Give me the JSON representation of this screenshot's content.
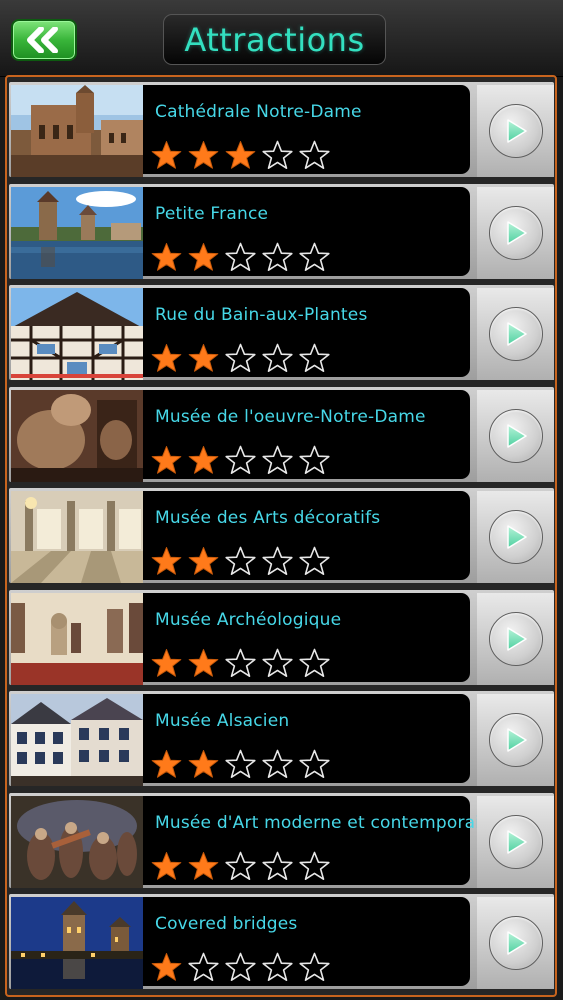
{
  "header": {
    "title": "Attractions",
    "back_icon": "double-chevron-left-icon"
  },
  "colors": {
    "accent_title": "#33e0c0",
    "item_name": "#47d8e8",
    "star_filled": "#ff7a1a",
    "frame_border": "#c8641e",
    "back_button": "#39b53a"
  },
  "items": [
    {
      "name": "Cathédrale Notre-Dame",
      "rating": 3,
      "max_rating": 5,
      "thumb": "cathedral"
    },
    {
      "name": "Petite France",
      "rating": 2,
      "max_rating": 5,
      "thumb": "river-towers"
    },
    {
      "name": "Rue du Bain-aux-Plantes",
      "rating": 2,
      "max_rating": 5,
      "thumb": "half-timbered"
    },
    {
      "name": "Musée de l'oeuvre-Notre-Dame",
      "rating": 2,
      "max_rating": 5,
      "thumb": "sculpture"
    },
    {
      "name": "Musée des Arts décoratifs",
      "rating": 2,
      "max_rating": 5,
      "thumb": "palace-hall"
    },
    {
      "name": "Musée Archéologique",
      "rating": 2,
      "max_rating": 5,
      "thumb": "museum-room"
    },
    {
      "name": "Musée Alsacien",
      "rating": 2,
      "max_rating": 5,
      "thumb": "alsatian-houses"
    },
    {
      "name": "Musée d'Art moderne et contemporain",
      "rating": 2,
      "max_rating": 5,
      "thumb": "painting"
    },
    {
      "name": "Covered bridges",
      "rating": 1,
      "max_rating": 5,
      "thumb": "night-towers"
    }
  ]
}
